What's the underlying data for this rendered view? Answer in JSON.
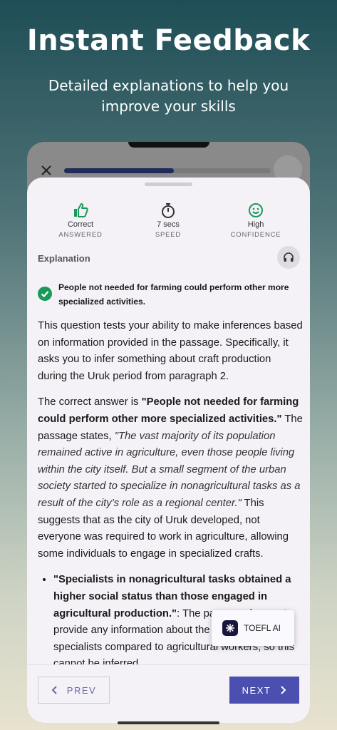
{
  "hero": {
    "title": "Instant Feedback",
    "subtitle": "Detailed explanations to help you improve your skills"
  },
  "quiz": {
    "progress_fraction": 0.53
  },
  "stats": [
    {
      "icon": "thumbs-up-icon",
      "value": "Correct",
      "label": "ANSWERED"
    },
    {
      "icon": "stopwatch-icon",
      "value": "7 secs",
      "label": "SPEED"
    },
    {
      "icon": "smiley-icon",
      "value": "High",
      "label": "CONFIDENCE"
    }
  ],
  "explanation": {
    "label": "Explanation",
    "correct_answer": "People not needed for farming could perform other more specialized activities.",
    "p1": "This question tests your ability to make inferences based on information provided in the passage. Specifically, it asks you to infer something about craft production during the Uruk period from paragraph 2.",
    "p2_intro": "The correct answer is ",
    "p2_answer": "\"People not needed for farming could perform other more specialized activities.\"",
    "p2_mid": " The passage states, ",
    "p2_quote": "\"The vast majority of its population remained active in agriculture, even those people living within the city itself. But a small segment of the urban society started to specialize in nonagricultural tasks as a result of the city’s role as a regional center.\"",
    "p2_end": " This suggests that as the city of Uruk developed, not everyone was required to work in agriculture, allowing some individuals to engage in specialized crafts.",
    "bullet1_bold": "\"Specialists in nonagricultural tasks obtained a higher social status than those engaged in agricultural production.\"",
    "bullet1_text": ": The passage does not provide any information about the social status of specialists compared to agricultural workers, so this cannot be inferred."
  },
  "footer": {
    "prev_label": "PREV",
    "next_label": "NEXT"
  },
  "assistant": {
    "label": "TOEFL AI"
  },
  "colors": {
    "accent": "#4a4fb0",
    "success": "#1a9a5a"
  }
}
